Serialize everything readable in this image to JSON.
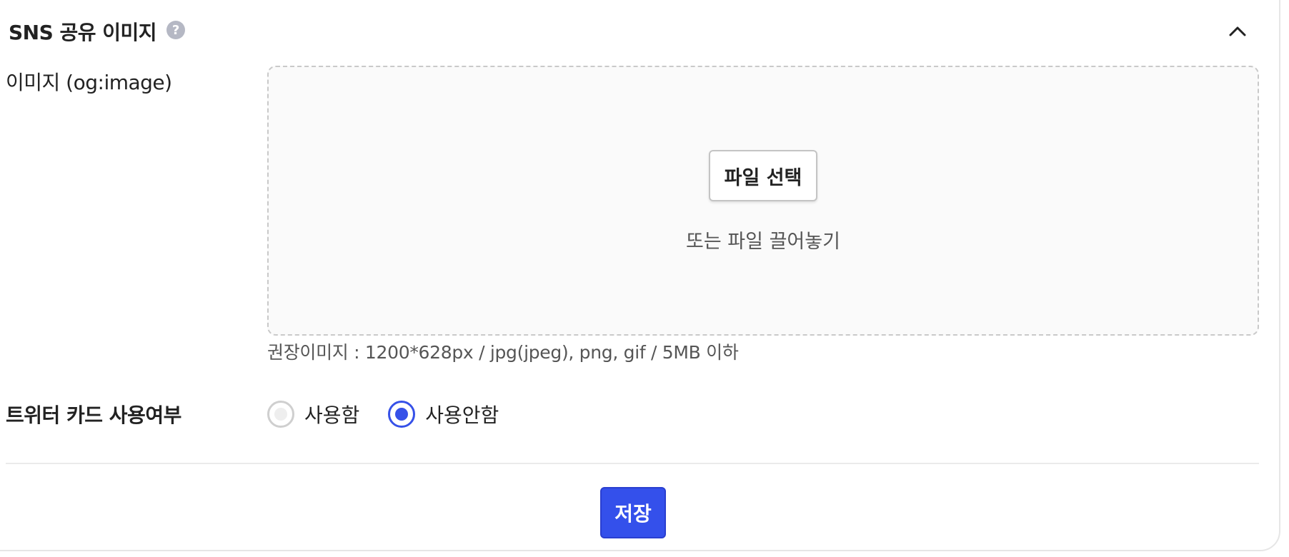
{
  "section": {
    "title": "SNS 공유 이미지",
    "help_icon": "?",
    "collapse_icon": "chevron-up-icon"
  },
  "og_image": {
    "label": "이미지 (og:image)",
    "file_button": "파일 선택",
    "drop_hint": "또는 파일 끌어놓기",
    "help_text": "권장이미지 : 1200*628px / jpg(jpeg), png, gif / 5MB 이하"
  },
  "twitter_card": {
    "label": "트위터 카드 사용여부",
    "options": [
      {
        "label": "사용함",
        "selected": false
      },
      {
        "label": "사용안함",
        "selected": true
      }
    ]
  },
  "save_button": "저장",
  "colors": {
    "accent": "#3450eb",
    "help_icon": "#b5b8c4"
  }
}
